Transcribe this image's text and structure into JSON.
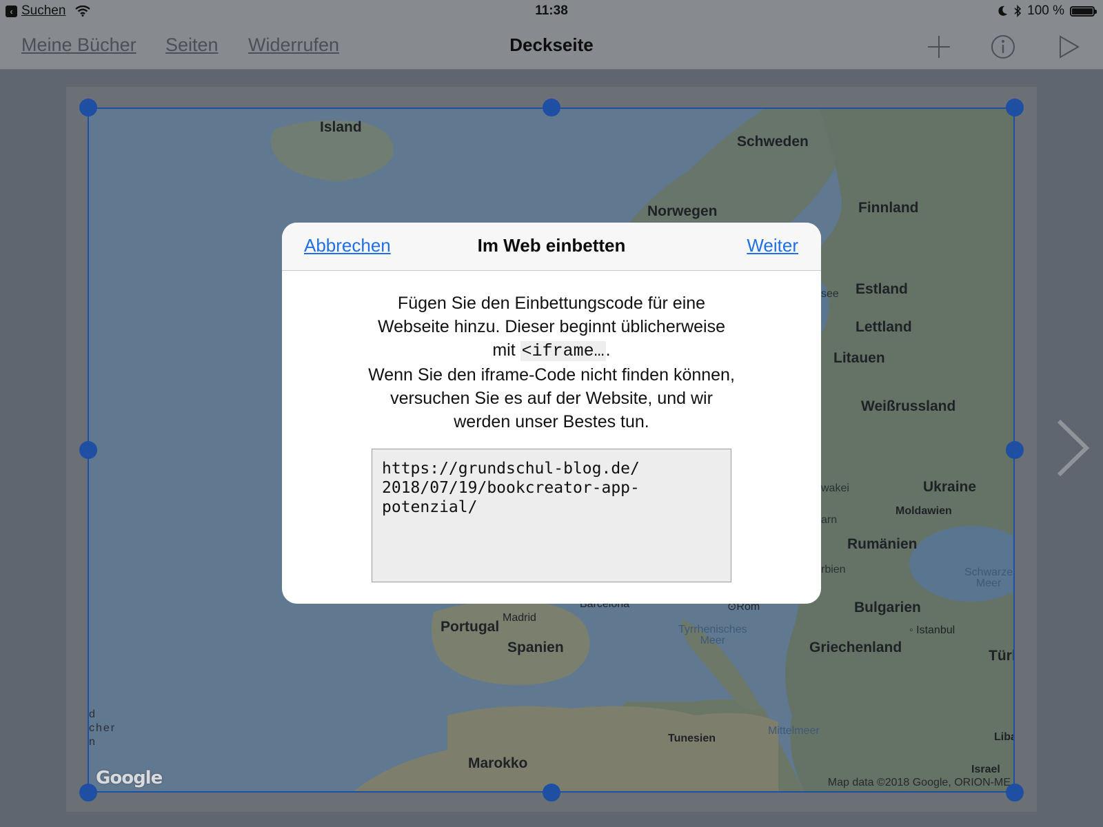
{
  "status_bar": {
    "back_label": "Suchen",
    "time": "11:38",
    "battery": "100 %",
    "battery_level": 1.0
  },
  "nav": {
    "my_books": "Meine Bücher",
    "pages": "Seiten",
    "undo": "Widerrufen",
    "title": "Deckseite",
    "icons": [
      "plus-icon",
      "info-icon",
      "play-icon"
    ]
  },
  "map": {
    "labels": {
      "island": "Island",
      "schweden": "Schweden",
      "norwegen": "Norwegen",
      "finnland": "Finnland",
      "estland": "Estland",
      "lettland": "Lettland",
      "litauen": "Litauen",
      "weissrussland": "Weißrussland",
      "ukraine": "Ukraine",
      "moldawien": "Moldawien",
      "rumaenien": "Rumänien",
      "bulgarien": "Bulgarien",
      "griechenland": "Griechenland",
      "istanbul": "Istanbul",
      "schwarzes_meer_1": "Schwarze",
      "schwarzes_meer_2": "Meer",
      "portugal": "Portugal",
      "spanien": "Spanien",
      "madrid": "Madrid",
      "barcelona": "Barcelona",
      "rom": "Rom",
      "tyrrhenisches_1": "Tyrrhenisches",
      "tyrrhenisches_2": "Meer",
      "tunesien": "Tunesien",
      "mittelmeer": "Mittelmeer",
      "marokko": "Marokko",
      "israel": "Israel",
      "libanon": "Liba",
      "tuerkei": "Türk",
      "cut_see": "see",
      "cut_wakei": "wakei",
      "cut_arn": "arn",
      "cut_rbien": "rbien",
      "cut_d": "d",
      "cut_cher": "cher",
      "cut_n": "n"
    },
    "logo": "Google",
    "attribution": "Map data ©2018 Google, ORION-ME"
  },
  "dialog": {
    "cancel": "Abbrechen",
    "title": "Im Web einbetten",
    "next": "Weiter",
    "text_1": "Fügen Sie den Einbettungscode für eine Webseite hinzu. Dieser beginnt üblicherweise mit ",
    "code": "<iframe…",
    "text_2": ".",
    "text_3": "Wenn Sie den iframe-Code nicht finden können, versuchen Sie es auf der Website, und wir werden unser Bestes tun.",
    "input_value": "https://grundschul-blog.de/\n2018/07/19/bookcreator-app-\npotenzial/"
  },
  "colors": {
    "link": "#1f6fe6",
    "selection": "#1e4fa3",
    "dim_overlay": "#878a8f"
  }
}
